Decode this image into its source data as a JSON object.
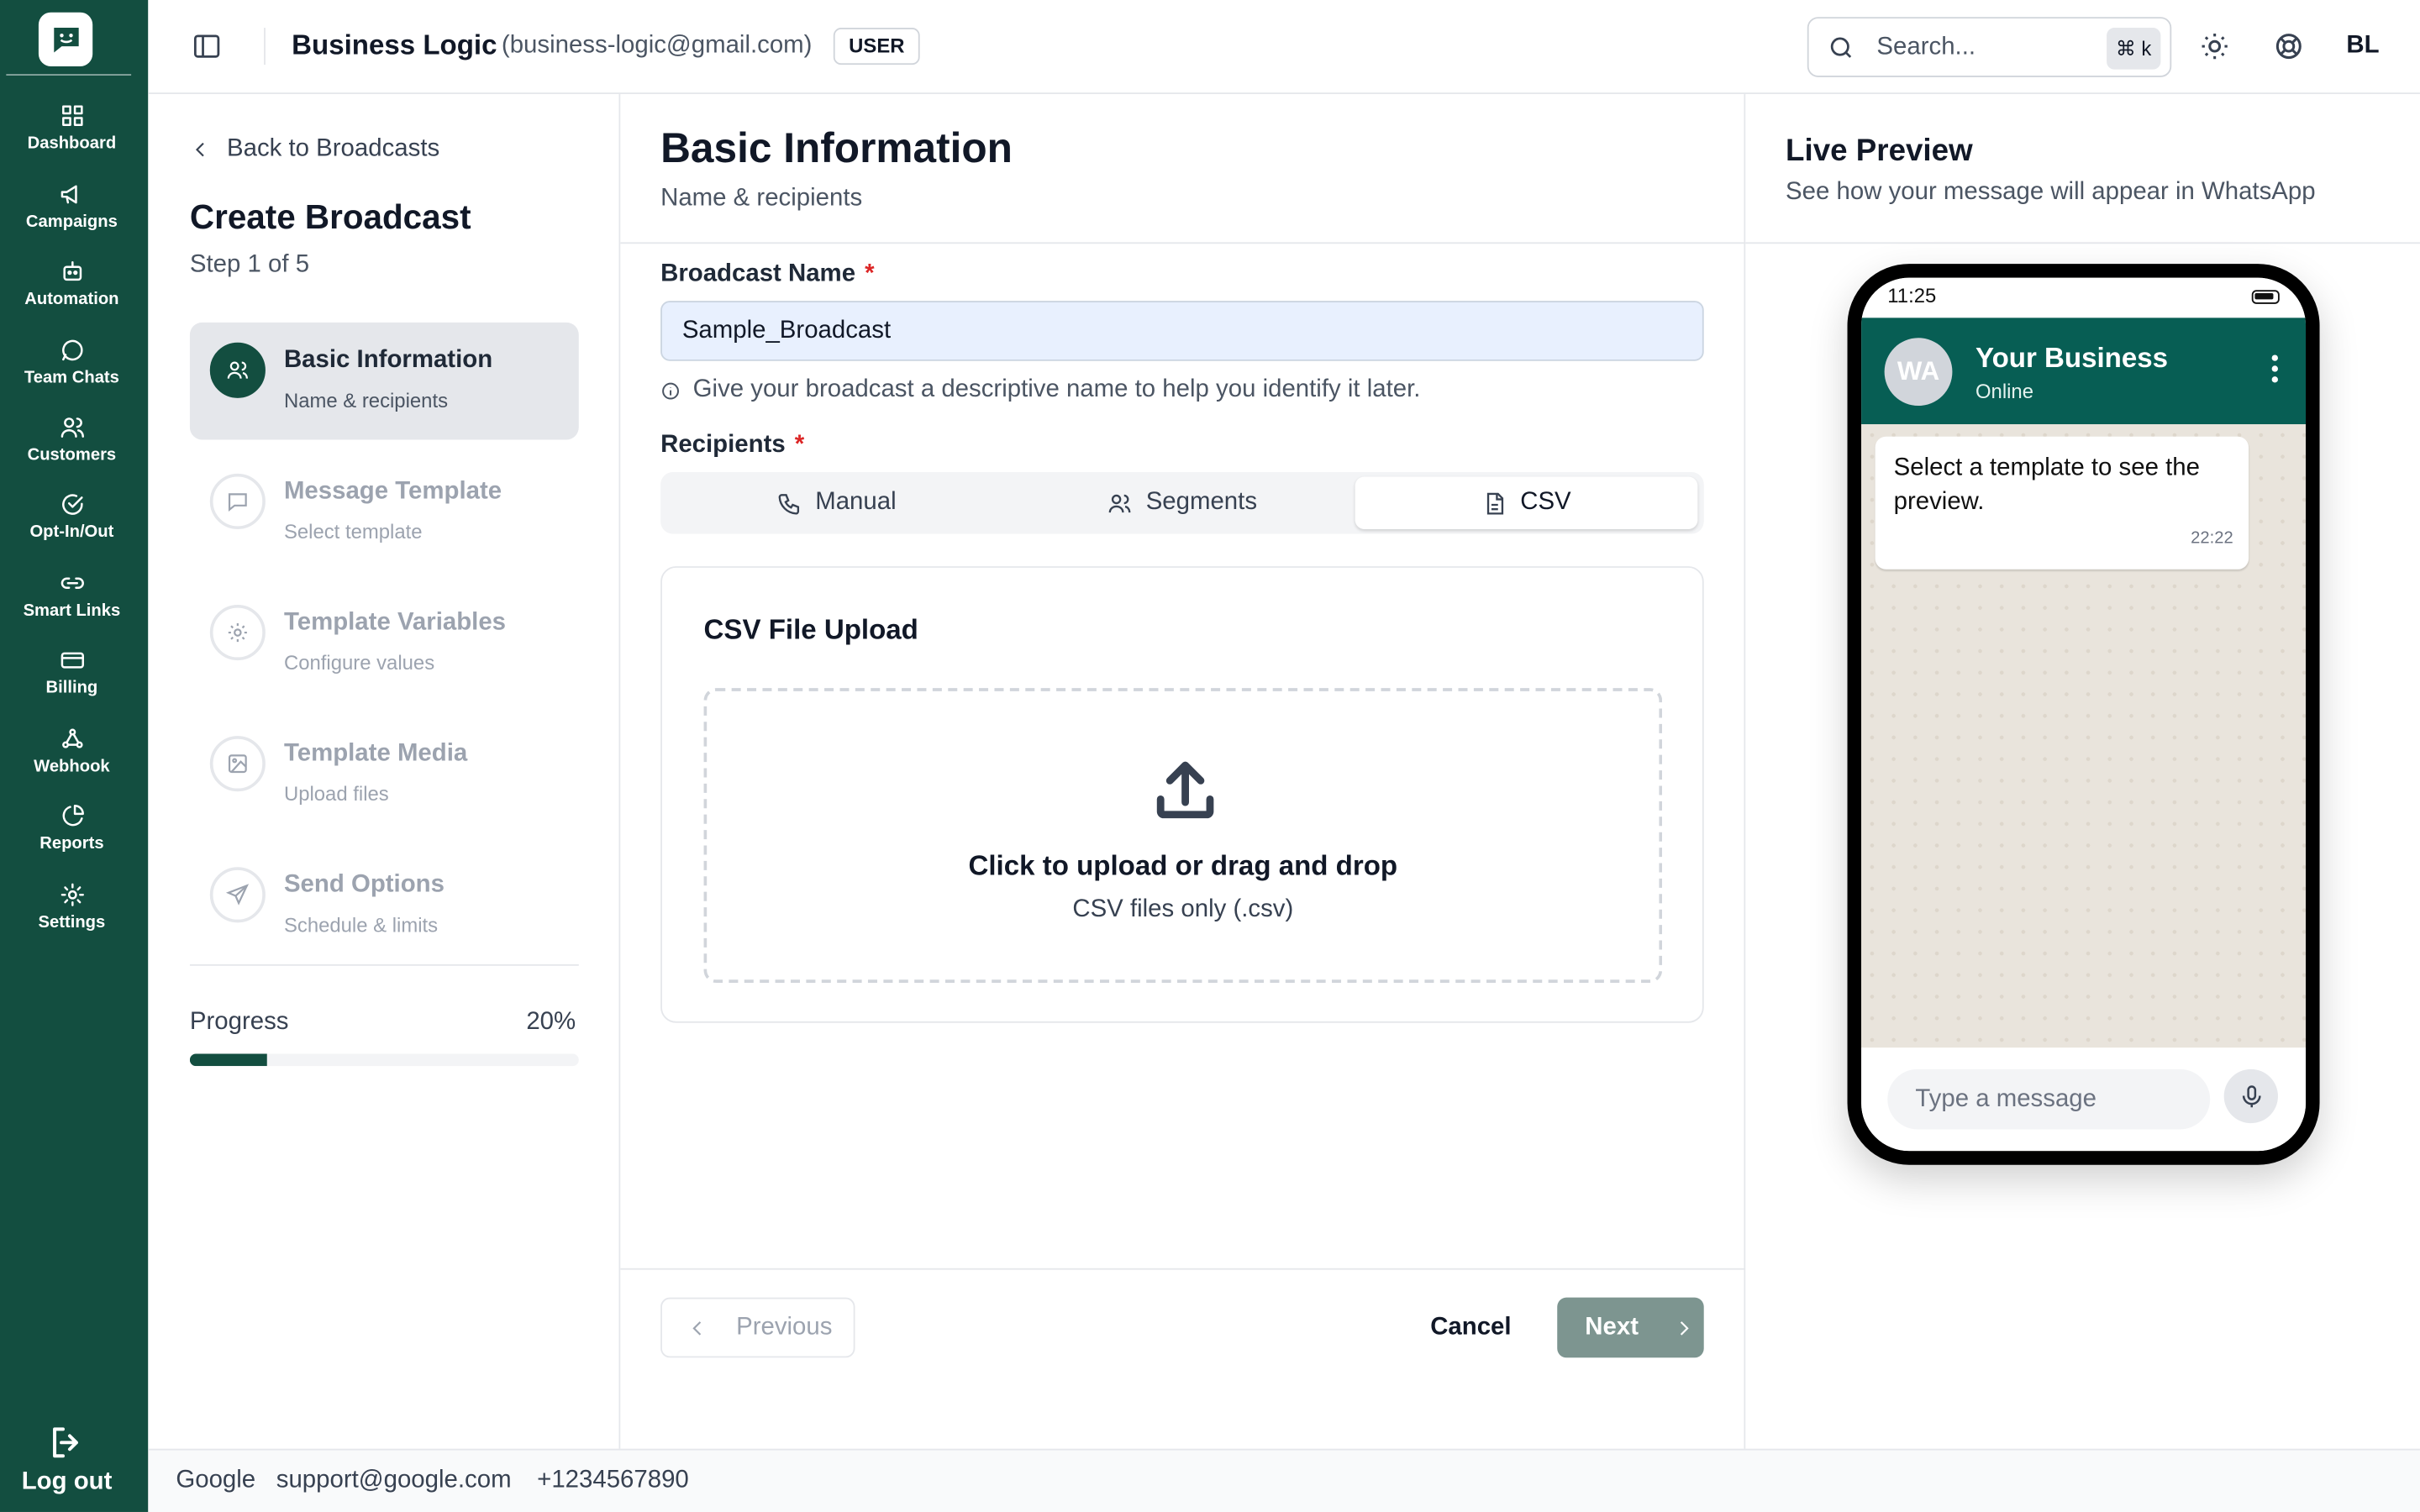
{
  "rail": {
    "items": [
      {
        "label": "Dashboard",
        "icon": "dashboard-icon"
      },
      {
        "label": "Campaigns",
        "icon": "megaphone-icon"
      },
      {
        "label": "Automation",
        "icon": "bot-icon"
      },
      {
        "label": "Team Chats",
        "icon": "chat-icon"
      },
      {
        "label": "Customers",
        "icon": "users-icon"
      },
      {
        "label": "Opt-In/Out",
        "icon": "check-circle-icon"
      },
      {
        "label": "Smart Links",
        "icon": "link-icon"
      },
      {
        "label": "Billing",
        "icon": "card-icon"
      },
      {
        "label": "Webhook",
        "icon": "webhook-icon"
      },
      {
        "label": "Reports",
        "icon": "pie-chart-icon"
      },
      {
        "label": "Settings",
        "icon": "gear-icon"
      }
    ],
    "logout": "Log out"
  },
  "header": {
    "business_name": "Business Logic",
    "business_email": "(business-logic@gmail.com)",
    "role": "USER",
    "search_placeholder": "Search...",
    "shortcut": "⌘ k",
    "avatar_initials": "BL"
  },
  "steps": {
    "back_label": "Back to Broadcasts",
    "title": "Create Broadcast",
    "step_counter": "Step 1 of 5",
    "items": [
      {
        "title": "Basic Information",
        "subtitle": "Name & recipients"
      },
      {
        "title": "Message Template",
        "subtitle": "Select template"
      },
      {
        "title": "Template Variables",
        "subtitle": "Configure values"
      },
      {
        "title": "Template Media",
        "subtitle": "Upload files"
      },
      {
        "title": "Send Options",
        "subtitle": "Schedule & limits"
      }
    ],
    "progress_label": "Progress",
    "progress_value": "20%",
    "progress_fraction": 0.2
  },
  "main": {
    "title": "Basic Information",
    "subtitle": "Name & recipients",
    "broadcast_name_label": "Broadcast Name",
    "required_mark": "*",
    "broadcast_name_value": "Sample_Broadcast",
    "broadcast_name_hint": "Give your broadcast a descriptive name to help you identify it later.",
    "recipients_label": "Recipients",
    "tabs": [
      {
        "label": "Manual"
      },
      {
        "label": "Segments"
      },
      {
        "label": "CSV"
      }
    ],
    "active_tab": "CSV",
    "csv": {
      "title": "CSV File Upload",
      "drop_primary": "Click to upload or drag and drop",
      "drop_secondary": "CSV files only (.csv)"
    },
    "buttons": {
      "previous": "Previous",
      "cancel": "Cancel",
      "next": "Next"
    }
  },
  "preview": {
    "title": "Live Preview",
    "subtitle": "See how your message will appear in WhatsApp",
    "phone": {
      "time": "11:25",
      "avatar": "WA",
      "business_name": "Your Business",
      "status": "Online",
      "message": "Select a template to see the preview.",
      "message_time": "22:22",
      "input_placeholder": "Type a message"
    }
  },
  "footer": {
    "company": "Google",
    "email": "support@google.com",
    "phone": "+1234567890"
  },
  "colors": {
    "brand": "#134e40",
    "whatsapp_header": "#075e54",
    "required": "#dc2626",
    "next_disabled": "#7d9590"
  }
}
